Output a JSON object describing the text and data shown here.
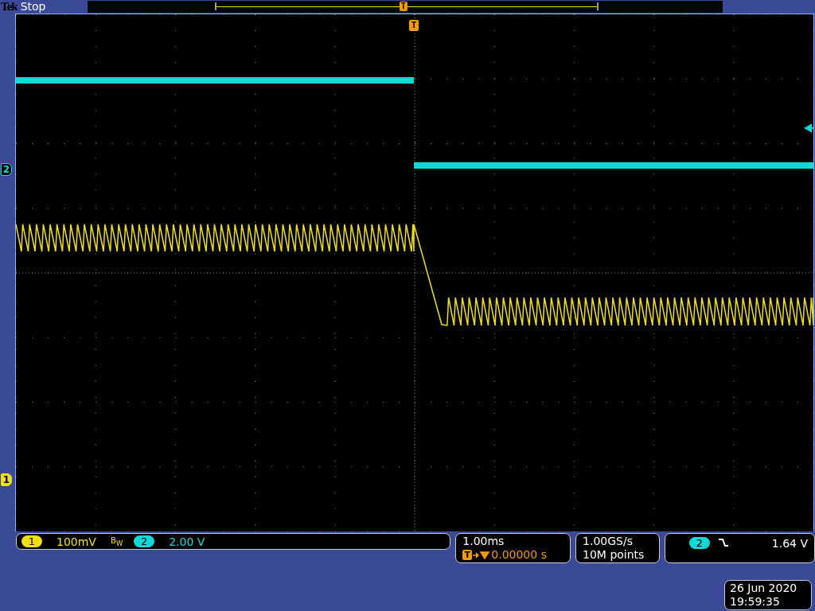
{
  "brand": "Tek",
  "status": "Stop",
  "record_view": {
    "trigger_marker": "T"
  },
  "graticule": {
    "trigger_marker": "T"
  },
  "offset_markers": [
    {
      "label": "2",
      "color": "#10d8d8",
      "filled": false
    },
    {
      "label": "1",
      "color": "#f0e010",
      "filled": true
    }
  ],
  "channels": [
    {
      "number": "1",
      "scale": "100mV",
      "color": "#f0e010",
      "bandwidth_limit": "B$_{W}$"
    },
    {
      "number": "2",
      "scale": "2.00 V",
      "color": "#10d8d8"
    }
  ],
  "timebase": {
    "scale": "1.00ms",
    "trigger_marker": "T",
    "position": "0.00000 s"
  },
  "acquisition": {
    "sample_rate": "1.00GS/s",
    "record_length": "10M points"
  },
  "trigger": {
    "source": "2",
    "level": "1.64 V"
  },
  "date": "26 Jun 2020",
  "time": "19:59:35"
}
